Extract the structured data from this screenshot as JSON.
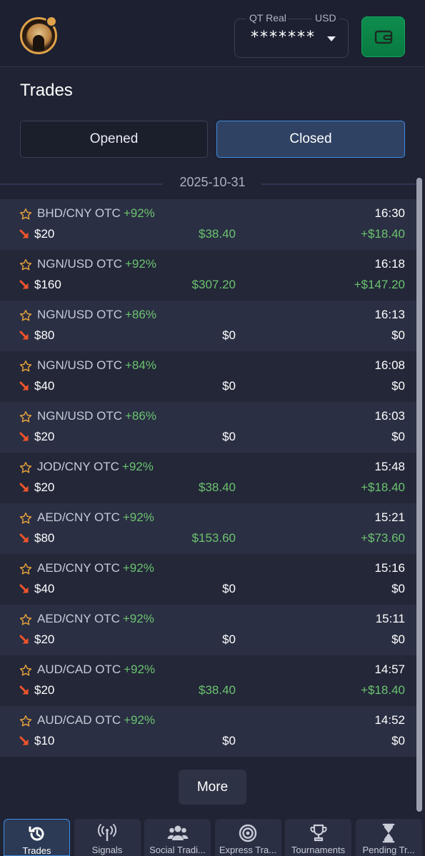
{
  "header": {
    "account_name": "QT Real",
    "currency": "USD",
    "balance_masked": "*******"
  },
  "page_title": "Trades",
  "tabs": {
    "opened": "Opened",
    "closed": "Closed"
  },
  "date_group": "2025-10-31",
  "trades": [
    {
      "pair": "BHD/CNY OTC",
      "pct": "+92%",
      "time": "16:30",
      "amount": "$20",
      "payout": "$38.40",
      "profit": "+$18.40",
      "win": true
    },
    {
      "pair": "NGN/USD OTC",
      "pct": "+92%",
      "time": "16:18",
      "amount": "$160",
      "payout": "$307.20",
      "profit": "+$147.20",
      "win": true
    },
    {
      "pair": "NGN/USD OTC",
      "pct": "+86%",
      "time": "16:13",
      "amount": "$80",
      "payout": "$0",
      "profit": "$0",
      "win": false
    },
    {
      "pair": "NGN/USD OTC",
      "pct": "+84%",
      "time": "16:08",
      "amount": "$40",
      "payout": "$0",
      "profit": "$0",
      "win": false
    },
    {
      "pair": "NGN/USD OTC",
      "pct": "+86%",
      "time": "16:03",
      "amount": "$20",
      "payout": "$0",
      "profit": "$0",
      "win": false
    },
    {
      "pair": "JOD/CNY OTC",
      "pct": "+92%",
      "time": "15:48",
      "amount": "$20",
      "payout": "$38.40",
      "profit": "+$18.40",
      "win": true
    },
    {
      "pair": "AED/CNY OTC",
      "pct": "+92%",
      "time": "15:21",
      "amount": "$80",
      "payout": "$153.60",
      "profit": "+$73.60",
      "win": true
    },
    {
      "pair": "AED/CNY OTC",
      "pct": "+92%",
      "time": "15:16",
      "amount": "$40",
      "payout": "$0",
      "profit": "$0",
      "win": false
    },
    {
      "pair": "AED/CNY OTC",
      "pct": "+92%",
      "time": "15:11",
      "amount": "$20",
      "payout": "$0",
      "profit": "$0",
      "win": false
    },
    {
      "pair": "AUD/CAD OTC",
      "pct": "+92%",
      "time": "14:57",
      "amount": "$20",
      "payout": "$38.40",
      "profit": "+$18.40",
      "win": true
    },
    {
      "pair": "AUD/CAD OTC",
      "pct": "+92%",
      "time": "14:52",
      "amount": "$10",
      "payout": "$0",
      "profit": "$0",
      "win": false
    }
  ],
  "more_label": "More",
  "nav": [
    {
      "label": "Trades",
      "icon": "history-clock-icon"
    },
    {
      "label": "Signals",
      "icon": "signal-tower-icon"
    },
    {
      "label": "Social Tradi...",
      "icon": "users-group-icon"
    },
    {
      "label": "Express Tra...",
      "icon": "target-icon"
    },
    {
      "label": "Tournaments",
      "icon": "trophy-icon"
    },
    {
      "label": "Pending Tr...",
      "icon": "hourglass-icon"
    }
  ],
  "colors": {
    "background": "#1f2333",
    "accent_blue": "#3f8be0",
    "profit_green": "#6cc36f",
    "star_orange": "#e8a23c",
    "down_arrow_red": "#f0542a",
    "wallet_green": "#0e8d4e"
  }
}
